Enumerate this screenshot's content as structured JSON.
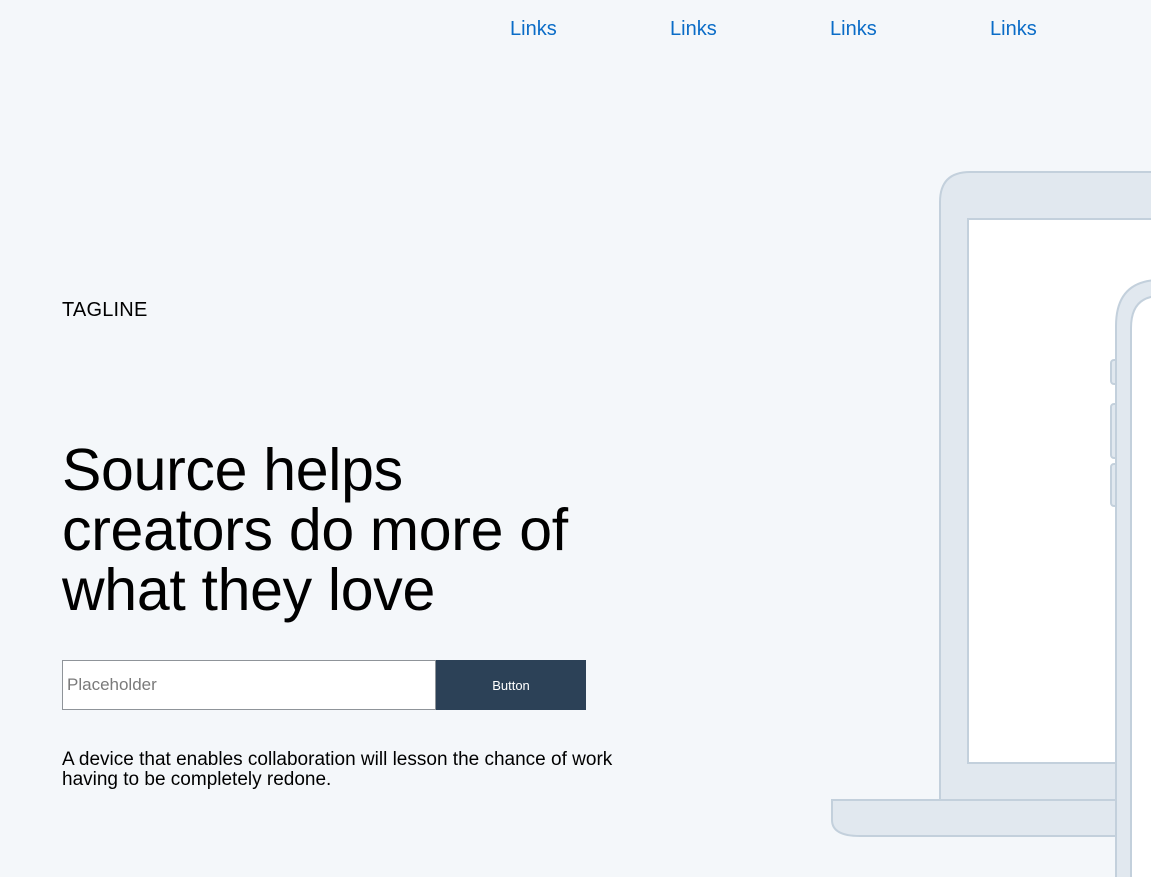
{
  "nav": {
    "links": [
      {
        "label": "Links"
      },
      {
        "label": "Links"
      },
      {
        "label": "Links"
      },
      {
        "label": "Links"
      }
    ]
  },
  "hero": {
    "tagline": "TAGLINE",
    "headline": "Source helps creators do more of what they love",
    "form": {
      "input_placeholder": "Placeholder",
      "input_value": "",
      "button_label": "Button"
    },
    "description": "A device that enables collaboration will lesson the chance of work having to be completely redone."
  },
  "colors": {
    "background": "#f4f7fa",
    "link": "#0a6cc7",
    "button": "#2c4157",
    "device_frame": "#e1e8ef",
    "device_outline": "#c3d0dc"
  },
  "illustration": {
    "laptop_icon": "laptop-icon",
    "phone_icon": "phone-icon"
  }
}
